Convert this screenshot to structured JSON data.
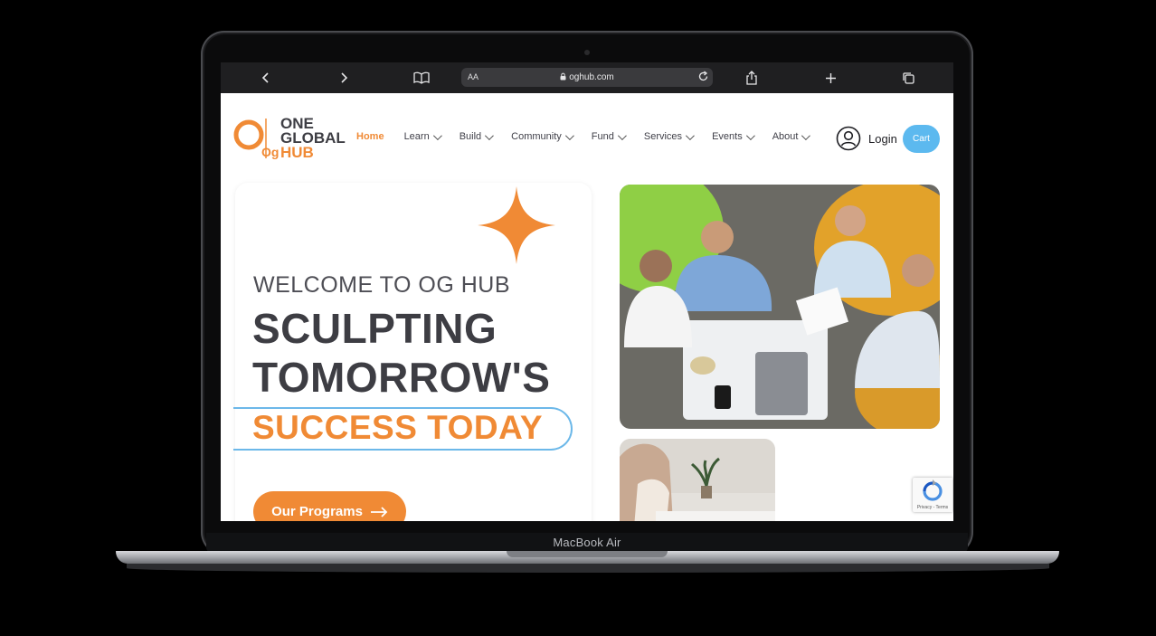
{
  "device": {
    "brand_label": "MacBook Air"
  },
  "browser": {
    "text_size_label": "AA",
    "url": "oghub.com",
    "icons": [
      "back-icon",
      "forward-icon",
      "bookmarks-icon",
      "lock-icon",
      "reload-icon",
      "share-icon",
      "new-tab-icon",
      "tabs-icon"
    ]
  },
  "site": {
    "logo": {
      "mark": "Og",
      "line1": "ONE",
      "line2": "GLOBAL",
      "line3": "HUB"
    },
    "nav": [
      {
        "label": "Home",
        "active": true,
        "dropdown": false
      },
      {
        "label": "Learn",
        "active": false,
        "dropdown": true
      },
      {
        "label": "Build",
        "active": false,
        "dropdown": true
      },
      {
        "label": "Community",
        "active": false,
        "dropdown": true
      },
      {
        "label": "Fund",
        "active": false,
        "dropdown": true
      },
      {
        "label": "Services",
        "active": false,
        "dropdown": true
      },
      {
        "label": "Events",
        "active": false,
        "dropdown": true
      },
      {
        "label": "About",
        "active": false,
        "dropdown": true
      }
    ],
    "login_label": "Login",
    "cart_label": "Cart"
  },
  "hero": {
    "eyebrow": "WELCOME TO OG HUB",
    "headline_1": "SCULPTING",
    "headline_2": "TOMORROW'S",
    "highlight": "SUCCESS TODAY",
    "cta_label": "Our Programs"
  },
  "recaptcha": {
    "footer": "Privacy - Terms"
  },
  "colors": {
    "accent": "#f08a35",
    "accent_blue": "#5cb9ef",
    "text_dark": "#3d3d43"
  }
}
